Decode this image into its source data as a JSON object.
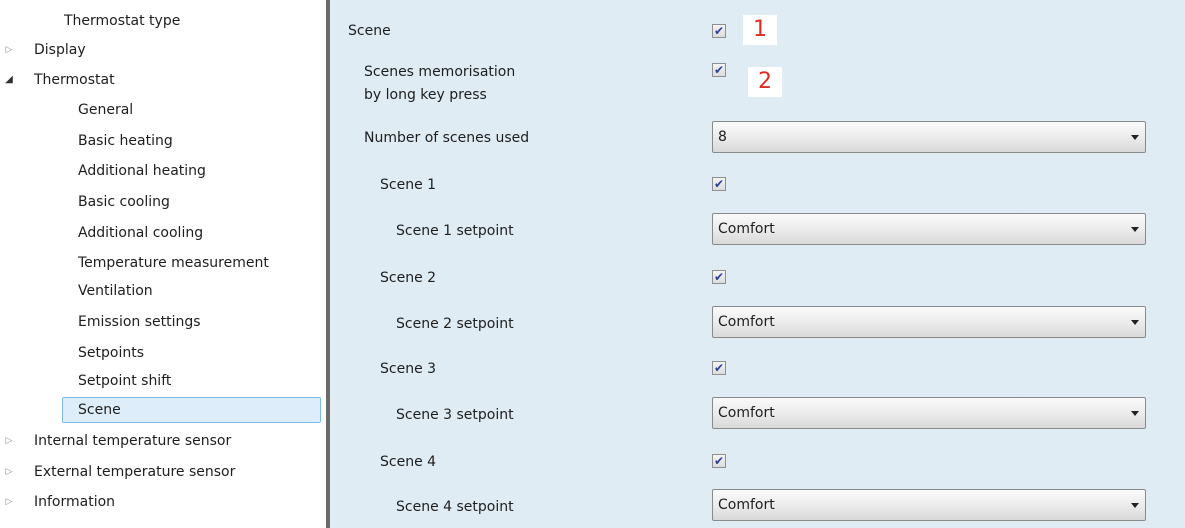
{
  "sidebar": {
    "items": [
      {
        "label": "Thermostat type",
        "arrow": ""
      },
      {
        "label": "Display",
        "arrow": "▷"
      },
      {
        "label": "Thermostat",
        "arrow": "◢"
      },
      {
        "label": "General",
        "arrow": ""
      },
      {
        "label": "Basic heating",
        "arrow": ""
      },
      {
        "label": "Additional heating",
        "arrow": ""
      },
      {
        "label": "Basic cooling",
        "arrow": ""
      },
      {
        "label": "Additional cooling",
        "arrow": ""
      },
      {
        "label": "Temperature measurement",
        "arrow": ""
      },
      {
        "label": "Ventilation",
        "arrow": ""
      },
      {
        "label": "Emission settings",
        "arrow": ""
      },
      {
        "label": "Setpoints",
        "arrow": ""
      },
      {
        "label": "Setpoint shift",
        "arrow": ""
      },
      {
        "label": "Scene",
        "arrow": ""
      },
      {
        "label": "Internal temperature sensor",
        "arrow": "▷"
      },
      {
        "label": "External temperature sensor",
        "arrow": "▷"
      },
      {
        "label": "Information",
        "arrow": "▷"
      }
    ],
    "selected": "Scene"
  },
  "params": {
    "scene": {
      "label": "Scene",
      "checked": true,
      "badge": "1"
    },
    "memorisation": {
      "label_line1": "Scenes memorisation",
      "label_line2": "by long key press",
      "checked": true,
      "badge": "2"
    },
    "number_of_scenes": {
      "label": "Number of scenes used",
      "value": "8"
    },
    "scenes": [
      {
        "label": "Scene 1",
        "checked": true,
        "setpoint_label": "Scene 1 setpoint",
        "setpoint_value": "Comfort"
      },
      {
        "label": "Scene 2",
        "checked": true,
        "setpoint_label": "Scene 2 setpoint",
        "setpoint_value": "Comfort"
      },
      {
        "label": "Scene 3",
        "checked": true,
        "setpoint_label": "Scene 3 setpoint",
        "setpoint_value": "Comfort"
      },
      {
        "label": "Scene 4",
        "checked": true,
        "setpoint_label": "Scene 4 setpoint",
        "setpoint_value": "Comfort"
      }
    ]
  },
  "icons": {
    "checkmark": "✔",
    "dropdown": "chevron-down-icon"
  },
  "colors": {
    "panel_bg": "#dfecf3",
    "badge_text": "#e02b20",
    "selected_bg": "#ddedf9",
    "selected_border": "#7dbbe6"
  }
}
